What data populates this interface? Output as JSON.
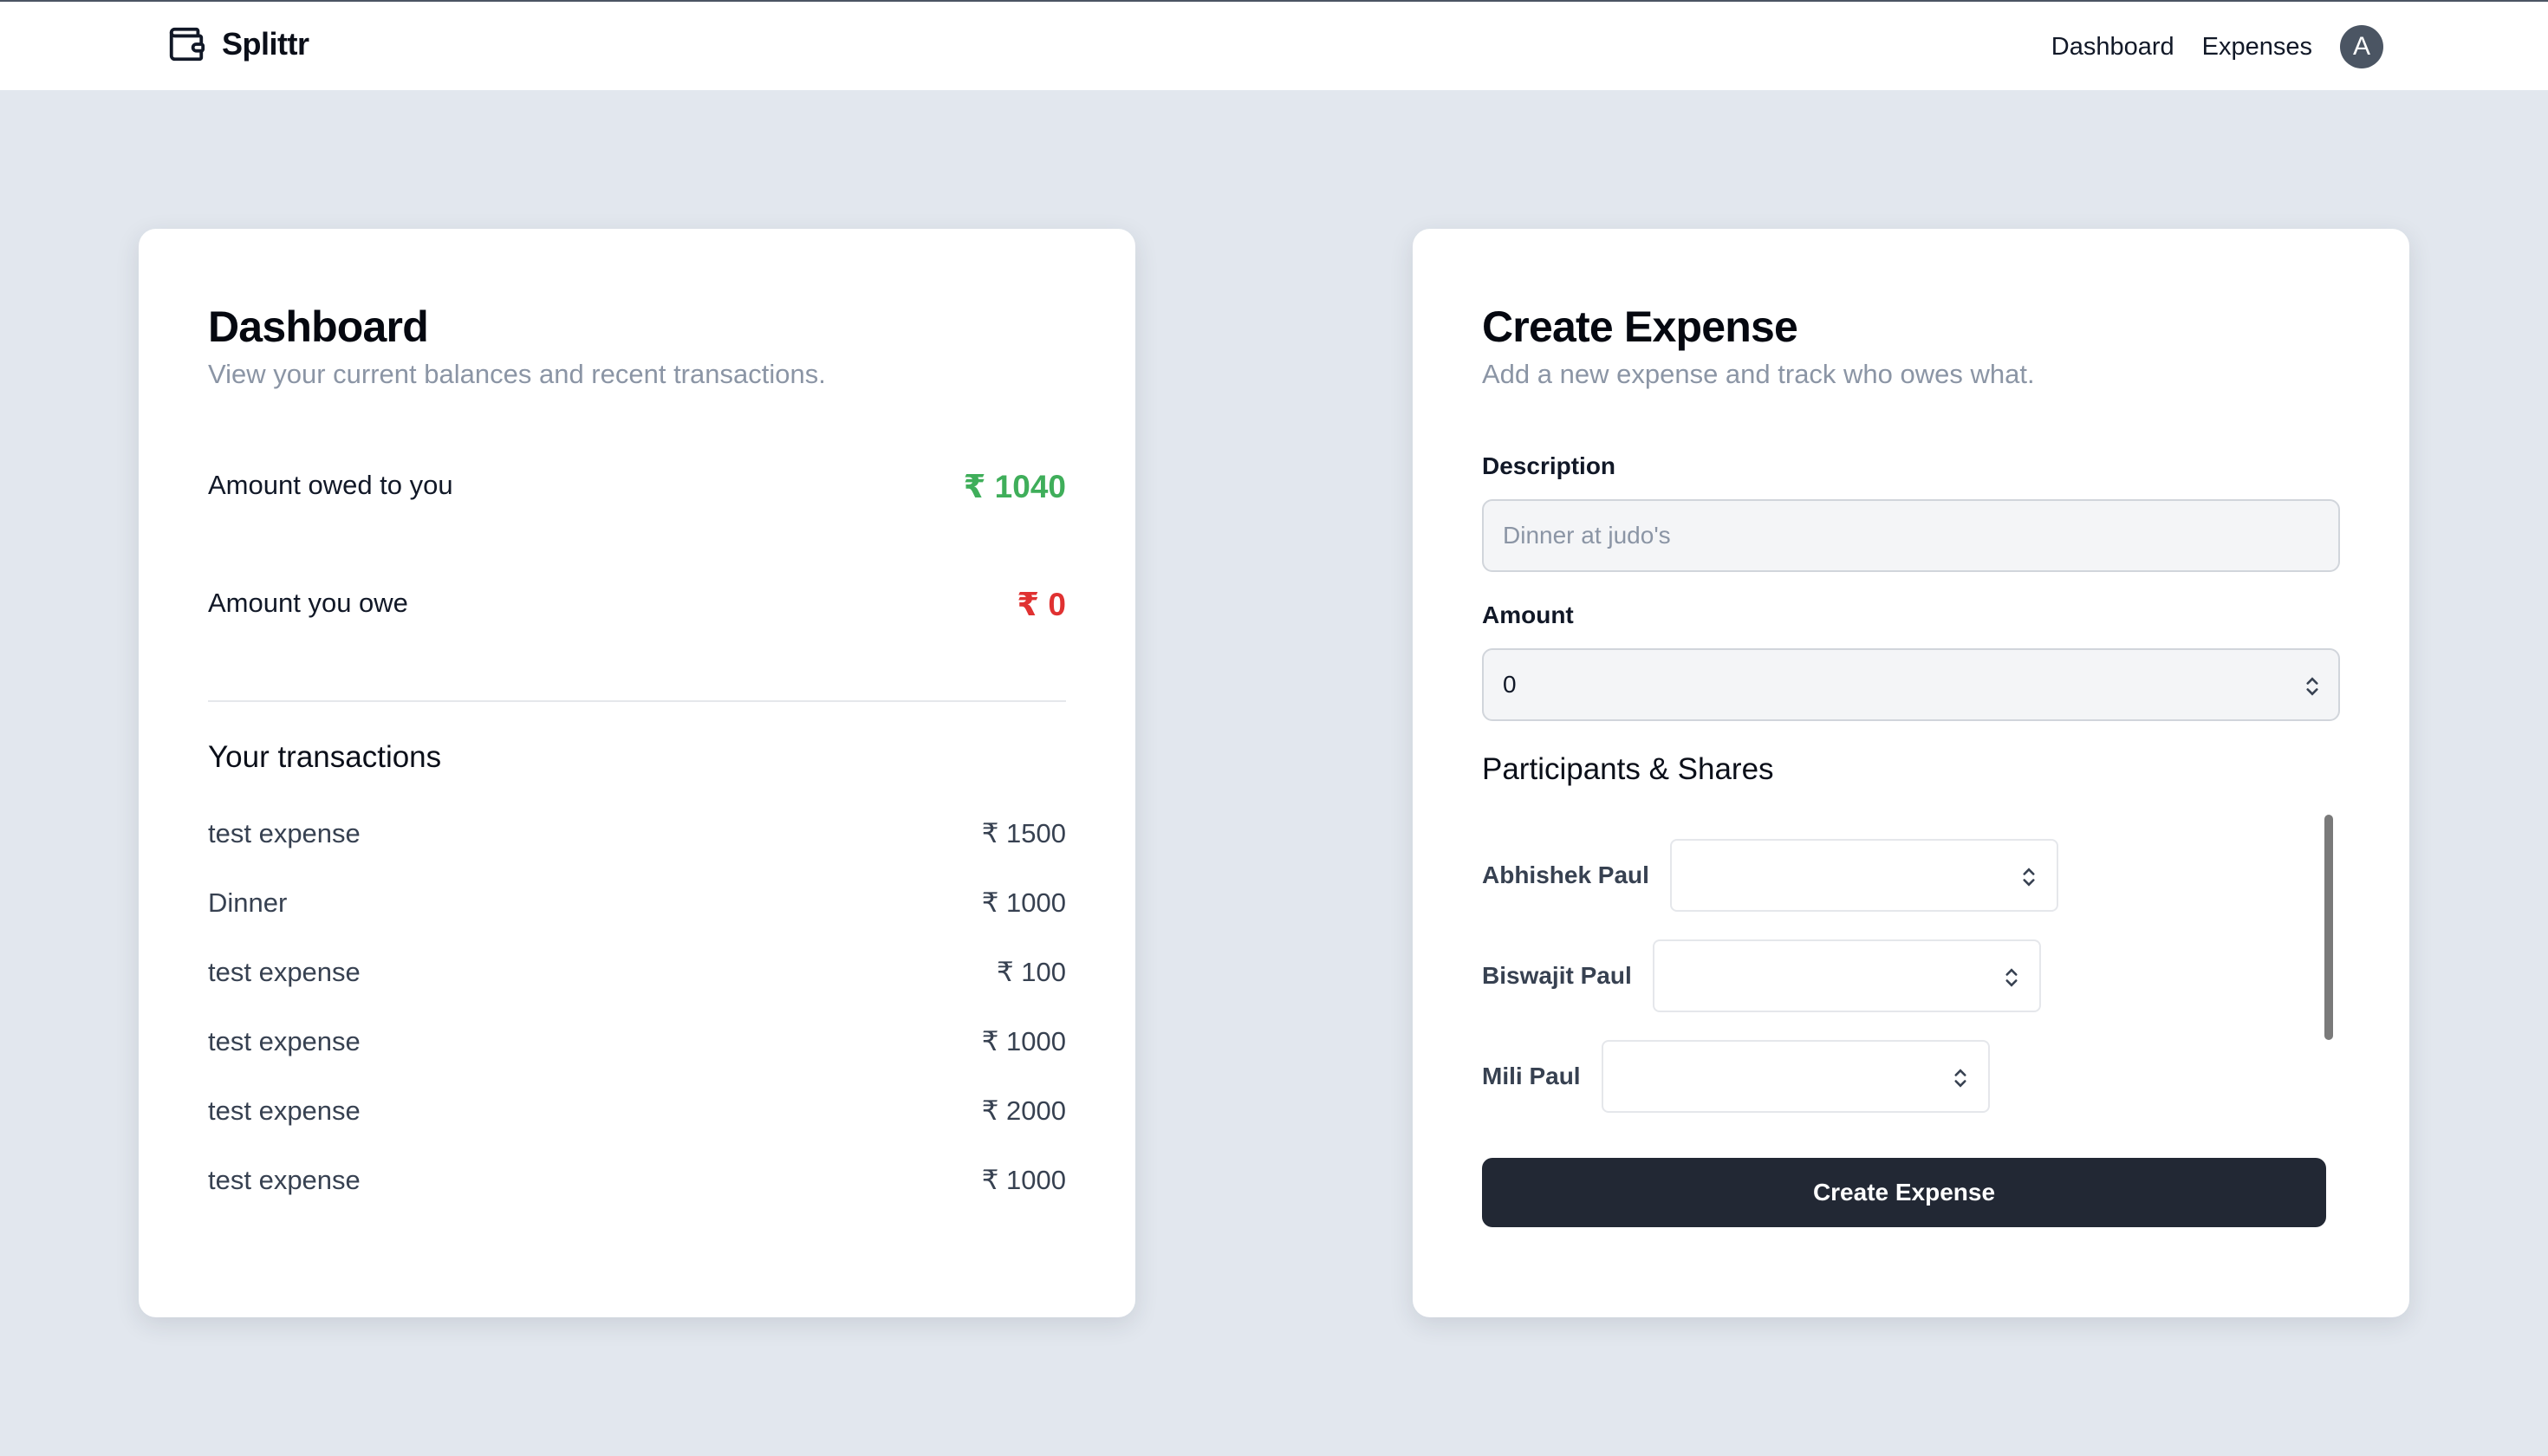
{
  "header": {
    "brand": "Splittr",
    "brand_icon": "wallet-icon",
    "nav": [
      {
        "label": "Dashboard"
      },
      {
        "label": "Expenses"
      }
    ],
    "avatar_initial": "A"
  },
  "dashboard": {
    "title": "Dashboard",
    "subtitle": "View your current balances and recent transactions.",
    "owed_to_you_label": "Amount owed to you",
    "owed_to_you_value": "₹ 1040",
    "you_owe_label": "Amount you owe",
    "you_owe_value": "₹ 0",
    "transactions_heading": "Your transactions",
    "transactions": [
      {
        "name": "test expense",
        "amount": "₹ 1500"
      },
      {
        "name": "Dinner",
        "amount": "₹ 1000"
      },
      {
        "name": "test expense",
        "amount": "₹ 100"
      },
      {
        "name": "test expense",
        "amount": "₹ 1000"
      },
      {
        "name": "test expense",
        "amount": "₹ 2000"
      },
      {
        "name": "test expense",
        "amount": "₹ 1000"
      }
    ],
    "colors": {
      "positive": "#3fae5a",
      "negative": "#e03131"
    }
  },
  "create_expense": {
    "title": "Create Expense",
    "subtitle": "Add a new expense and track who owes what.",
    "description_label": "Description",
    "description_placeholder": "Dinner at judo's",
    "amount_label": "Amount",
    "amount_value": "0",
    "participants_heading": "Participants & Shares",
    "participants": [
      {
        "name": "Abhishek Paul",
        "share": ""
      },
      {
        "name": "Biswajit Paul",
        "share": ""
      },
      {
        "name": "Mili Paul",
        "share": ""
      }
    ],
    "submit_label": "Create Expense",
    "button_color": "#222834"
  }
}
